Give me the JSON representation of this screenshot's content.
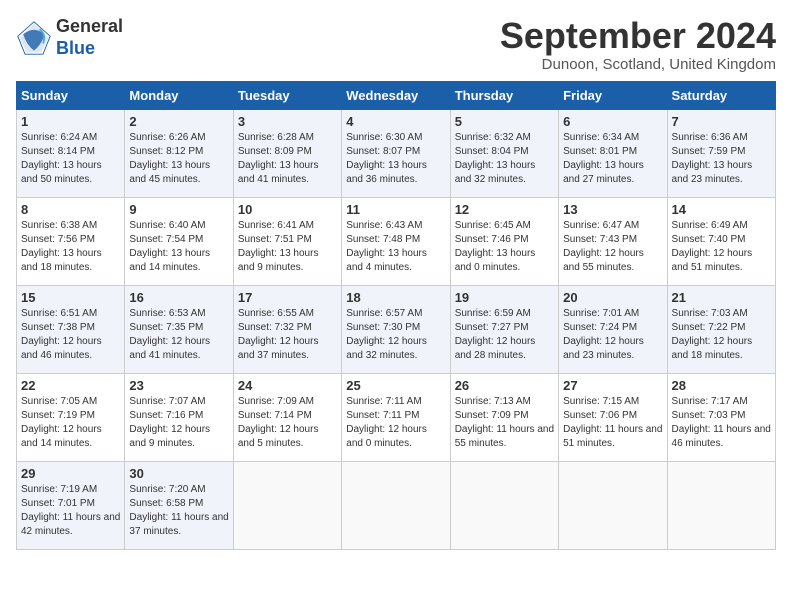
{
  "header": {
    "logo_general": "General",
    "logo_blue": "Blue",
    "month_title": "September 2024",
    "location": "Dunoon, Scotland, United Kingdom"
  },
  "weekdays": [
    "Sunday",
    "Monday",
    "Tuesday",
    "Wednesday",
    "Thursday",
    "Friday",
    "Saturday"
  ],
  "weeks": [
    [
      {
        "day": "1",
        "sunrise": "Sunrise: 6:24 AM",
        "sunset": "Sunset: 8:14 PM",
        "daylight": "Daylight: 13 hours and 50 minutes."
      },
      {
        "day": "2",
        "sunrise": "Sunrise: 6:26 AM",
        "sunset": "Sunset: 8:12 PM",
        "daylight": "Daylight: 13 hours and 45 minutes."
      },
      {
        "day": "3",
        "sunrise": "Sunrise: 6:28 AM",
        "sunset": "Sunset: 8:09 PM",
        "daylight": "Daylight: 13 hours and 41 minutes."
      },
      {
        "day": "4",
        "sunrise": "Sunrise: 6:30 AM",
        "sunset": "Sunset: 8:07 PM",
        "daylight": "Daylight: 13 hours and 36 minutes."
      },
      {
        "day": "5",
        "sunrise": "Sunrise: 6:32 AM",
        "sunset": "Sunset: 8:04 PM",
        "daylight": "Daylight: 13 hours and 32 minutes."
      },
      {
        "day": "6",
        "sunrise": "Sunrise: 6:34 AM",
        "sunset": "Sunset: 8:01 PM",
        "daylight": "Daylight: 13 hours and 27 minutes."
      },
      {
        "day": "7",
        "sunrise": "Sunrise: 6:36 AM",
        "sunset": "Sunset: 7:59 PM",
        "daylight": "Daylight: 13 hours and 23 minutes."
      }
    ],
    [
      {
        "day": "8",
        "sunrise": "Sunrise: 6:38 AM",
        "sunset": "Sunset: 7:56 PM",
        "daylight": "Daylight: 13 hours and 18 minutes."
      },
      {
        "day": "9",
        "sunrise": "Sunrise: 6:40 AM",
        "sunset": "Sunset: 7:54 PM",
        "daylight": "Daylight: 13 hours and 14 minutes."
      },
      {
        "day": "10",
        "sunrise": "Sunrise: 6:41 AM",
        "sunset": "Sunset: 7:51 PM",
        "daylight": "Daylight: 13 hours and 9 minutes."
      },
      {
        "day": "11",
        "sunrise": "Sunrise: 6:43 AM",
        "sunset": "Sunset: 7:48 PM",
        "daylight": "Daylight: 13 hours and 4 minutes."
      },
      {
        "day": "12",
        "sunrise": "Sunrise: 6:45 AM",
        "sunset": "Sunset: 7:46 PM",
        "daylight": "Daylight: 13 hours and 0 minutes."
      },
      {
        "day": "13",
        "sunrise": "Sunrise: 6:47 AM",
        "sunset": "Sunset: 7:43 PM",
        "daylight": "Daylight: 12 hours and 55 minutes."
      },
      {
        "day": "14",
        "sunrise": "Sunrise: 6:49 AM",
        "sunset": "Sunset: 7:40 PM",
        "daylight": "Daylight: 12 hours and 51 minutes."
      }
    ],
    [
      {
        "day": "15",
        "sunrise": "Sunrise: 6:51 AM",
        "sunset": "Sunset: 7:38 PM",
        "daylight": "Daylight: 12 hours and 46 minutes."
      },
      {
        "day": "16",
        "sunrise": "Sunrise: 6:53 AM",
        "sunset": "Sunset: 7:35 PM",
        "daylight": "Daylight: 12 hours and 41 minutes."
      },
      {
        "day": "17",
        "sunrise": "Sunrise: 6:55 AM",
        "sunset": "Sunset: 7:32 PM",
        "daylight": "Daylight: 12 hours and 37 minutes."
      },
      {
        "day": "18",
        "sunrise": "Sunrise: 6:57 AM",
        "sunset": "Sunset: 7:30 PM",
        "daylight": "Daylight: 12 hours and 32 minutes."
      },
      {
        "day": "19",
        "sunrise": "Sunrise: 6:59 AM",
        "sunset": "Sunset: 7:27 PM",
        "daylight": "Daylight: 12 hours and 28 minutes."
      },
      {
        "day": "20",
        "sunrise": "Sunrise: 7:01 AM",
        "sunset": "Sunset: 7:24 PM",
        "daylight": "Daylight: 12 hours and 23 minutes."
      },
      {
        "day": "21",
        "sunrise": "Sunrise: 7:03 AM",
        "sunset": "Sunset: 7:22 PM",
        "daylight": "Daylight: 12 hours and 18 minutes."
      }
    ],
    [
      {
        "day": "22",
        "sunrise": "Sunrise: 7:05 AM",
        "sunset": "Sunset: 7:19 PM",
        "daylight": "Daylight: 12 hours and 14 minutes."
      },
      {
        "day": "23",
        "sunrise": "Sunrise: 7:07 AM",
        "sunset": "Sunset: 7:16 PM",
        "daylight": "Daylight: 12 hours and 9 minutes."
      },
      {
        "day": "24",
        "sunrise": "Sunrise: 7:09 AM",
        "sunset": "Sunset: 7:14 PM",
        "daylight": "Daylight: 12 hours and 5 minutes."
      },
      {
        "day": "25",
        "sunrise": "Sunrise: 7:11 AM",
        "sunset": "Sunset: 7:11 PM",
        "daylight": "Daylight: 12 hours and 0 minutes."
      },
      {
        "day": "26",
        "sunrise": "Sunrise: 7:13 AM",
        "sunset": "Sunset: 7:09 PM",
        "daylight": "Daylight: 11 hours and 55 minutes."
      },
      {
        "day": "27",
        "sunrise": "Sunrise: 7:15 AM",
        "sunset": "Sunset: 7:06 PM",
        "daylight": "Daylight: 11 hours and 51 minutes."
      },
      {
        "day": "28",
        "sunrise": "Sunrise: 7:17 AM",
        "sunset": "Sunset: 7:03 PM",
        "daylight": "Daylight: 11 hours and 46 minutes."
      }
    ],
    [
      {
        "day": "29",
        "sunrise": "Sunrise: 7:19 AM",
        "sunset": "Sunset: 7:01 PM",
        "daylight": "Daylight: 11 hours and 42 minutes."
      },
      {
        "day": "30",
        "sunrise": "Sunrise: 7:20 AM",
        "sunset": "Sunset: 6:58 PM",
        "daylight": "Daylight: 11 hours and 37 minutes."
      },
      null,
      null,
      null,
      null,
      null
    ]
  ]
}
